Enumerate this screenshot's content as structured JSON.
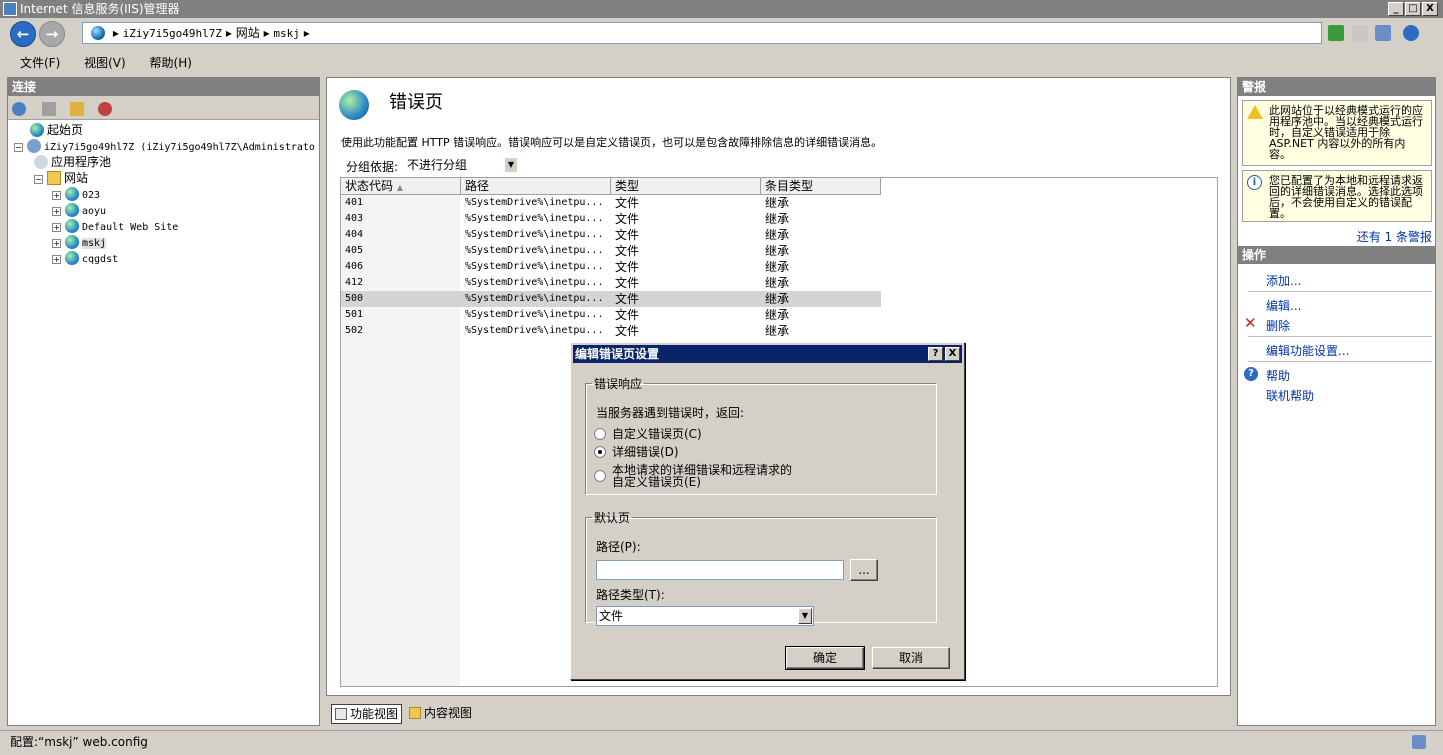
{
  "window": {
    "title": "Internet 信息服务(IIS)管理器",
    "min_label": "_",
    "max_label": "□",
    "close_label": "X"
  },
  "nav": {
    "back_label": "←",
    "forward_label": "→",
    "breadcrumb": [
      "iZiy7i5go49hl7Z",
      "网站",
      "mskj"
    ],
    "breadcrumb_sep": "▸"
  },
  "menu": {
    "items": [
      "文件(F)",
      "视图(V)",
      "帮助(H)"
    ]
  },
  "connections": {
    "title": "连接",
    "tree": [
      {
        "label": "起始页",
        "icon": "start-page-icon",
        "indent": 0
      },
      {
        "label": "iZiy7i5go49hl7Z (iZiy7i5go49hl7Z\\Administrato",
        "icon": "server-icon",
        "indent": 1,
        "expander": "⊟"
      },
      {
        "label": "应用程序池",
        "icon": "app-pool-icon",
        "indent": 2
      },
      {
        "label": "网站",
        "icon": "sites-folder-icon",
        "indent": 2,
        "expander": "⊟"
      },
      {
        "label": "023",
        "icon": "site-icon",
        "indent": 3,
        "expander": "⊞"
      },
      {
        "label": "aoyu",
        "icon": "site-icon",
        "indent": 3,
        "expander": "⊞"
      },
      {
        "label": "Default Web Site",
        "icon": "site-icon",
        "indent": 3,
        "expander": "⊞"
      },
      {
        "label": "mskj",
        "icon": "site-icon",
        "indent": 3,
        "expander": "⊞",
        "selected": true
      },
      {
        "label": "cqgdst",
        "icon": "site-icon",
        "indent": 3,
        "expander": "⊞"
      }
    ]
  },
  "main": {
    "title": "错误页",
    "description": "使用此功能配置 HTTP 错误响应。错误响应可以是自定义错误页，也可以是包含故障排除信息的详细错误消息。",
    "group_label": "分组依据:",
    "group_value": "不进行分组",
    "columns": [
      "状态代码",
      "路径",
      "类型",
      "条目类型"
    ],
    "rows": [
      {
        "code": "401",
        "path": "%SystemDrive%\\inetpu...",
        "type": "文件",
        "entry": "继承"
      },
      {
        "code": "403",
        "path": "%SystemDrive%\\inetpu...",
        "type": "文件",
        "entry": "继承"
      },
      {
        "code": "404",
        "path": "%SystemDrive%\\inetpu...",
        "type": "文件",
        "entry": "继承"
      },
      {
        "code": "405",
        "path": "%SystemDrive%\\inetpu...",
        "type": "文件",
        "entry": "继承"
      },
      {
        "code": "406",
        "path": "%SystemDrive%\\inetpu...",
        "type": "文件",
        "entry": "继承"
      },
      {
        "code": "412",
        "path": "%SystemDrive%\\inetpu...",
        "type": "文件",
        "entry": "继承"
      },
      {
        "code": "500",
        "path": "%SystemDrive%\\inetpu...",
        "type": "文件",
        "entry": "继承",
        "selected": true
      },
      {
        "code": "501",
        "path": "%SystemDrive%\\inetpu...",
        "type": "文件",
        "entry": "继承"
      },
      {
        "code": "502",
        "path": "%SystemDrive%\\inetpu...",
        "type": "文件",
        "entry": "继承"
      }
    ],
    "view_tabs": [
      "功能视图",
      "内容视图"
    ]
  },
  "alerts": {
    "title": "警报",
    "items": [
      {
        "icon": "warning-icon",
        "text": "此网站位于以经典模式运行的应用程序池中。当以经典模式运行时，自定义错误适用于除 ASP.NET 内容以外的所有内容。"
      },
      {
        "icon": "info-icon",
        "text": "您已配置了为本地和远程请求返回的详细错误消息。选择此选项后，不会使用自定义的错误配置。"
      }
    ],
    "more_link": "还有 1 条警报"
  },
  "actions": {
    "title": "操作",
    "items": [
      "添加...",
      "编辑...",
      "删除",
      "编辑功能设置...",
      "帮助",
      "联机帮助"
    ]
  },
  "status": {
    "text": "配置:“mskj” web.config"
  },
  "dialog": {
    "title": "编辑错误页设置",
    "help_label": "?",
    "close_label": "X",
    "response_group": "错误响应",
    "response_prompt": "当服务器遇到错误时，返回:",
    "options": [
      "自定义错误页(C)",
      "详细错误(D)",
      "本地请求的详细错误和远程请求的",
      "自定义错误页(E)"
    ],
    "selected_option": 1,
    "default_group": "默认页",
    "path_label": "路径(P):",
    "path_value": "",
    "browse_label": "...",
    "path_type_label": "路径类型(T):",
    "path_type_value": "文件",
    "ok_label": "确定",
    "cancel_label": "取消"
  },
  "colors": {
    "title_inactive": "#808080",
    "dialog_title": "#0a246a",
    "link": "#0033aa",
    "alert_bg": "#ffffe1"
  }
}
